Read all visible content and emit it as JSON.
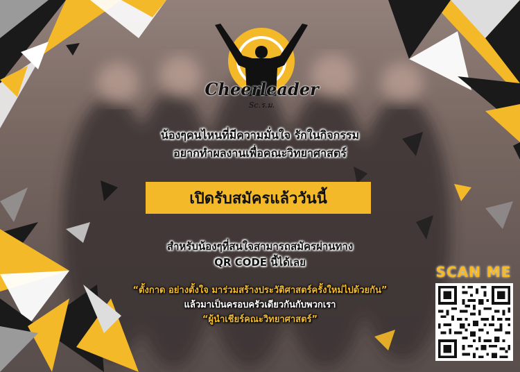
{
  "logo": {
    "title": "Cheerleader",
    "subtitle": "Sc.ร.ม."
  },
  "intro": {
    "line1": "น้องๆคนไหนที่มีความมั่นใจ รักในกิจกรรม",
    "line2": "อยากทำผลงานเพื่อคณะวิทยาศาสตร์"
  },
  "banner": {
    "label": "เปิดรับสมัครแล้ววันนี้"
  },
  "howto": {
    "line1": "สำหรับน้องๆที่สนใจสามารถสมัครผ่านทาง",
    "line2": "QR CODE นี้ได้เลย"
  },
  "quote": {
    "line1": "“ตั้งกาด อย่างตั้งใจ มาร่วมสร้างประวัติศาสตร์ครั้งใหม่ไปด้วยกัน”",
    "line2": "แล้วมาเป็นครอบครัวเดียวกันกับพวกเรา",
    "line3": "“ผู้นำเชียร์คณะวิทยาศาสตร์”"
  },
  "scan": {
    "label": "SCAN ME"
  },
  "colors": {
    "accent": "#f4b928",
    "dark": "#1a1a1a",
    "grey": "#9a9a9a"
  }
}
